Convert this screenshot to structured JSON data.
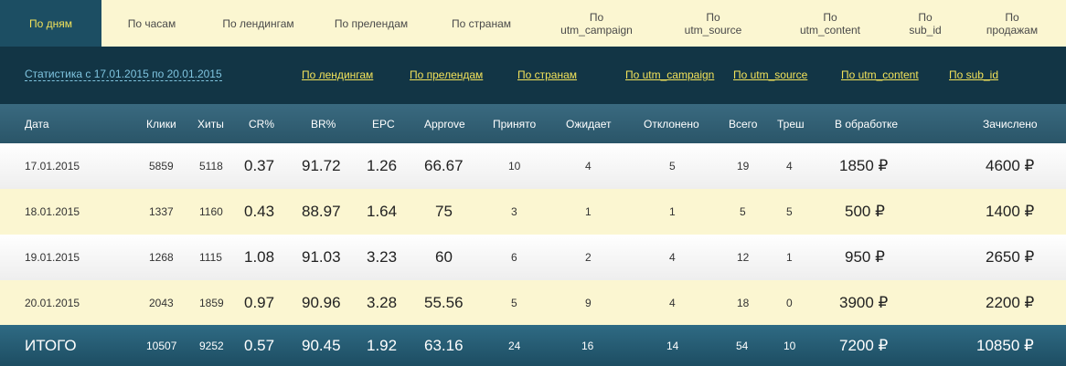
{
  "tabs": [
    {
      "label": "По дням",
      "active": true
    },
    {
      "label": "По часам"
    },
    {
      "label": "По лендингам"
    },
    {
      "label": "По прелендам"
    },
    {
      "label": "По странам"
    },
    {
      "label": "По\nutm_campaign"
    },
    {
      "label": "По\nutm_source"
    },
    {
      "label": "По\nutm_content"
    },
    {
      "label": "По\nsub_id"
    },
    {
      "label": "По\nпродажам"
    }
  ],
  "subnav": {
    "range": "Статистика с 17.01.2015 по 20.01.2015",
    "links": [
      "По лендингам",
      "По прелендам",
      "По странам",
      "По utm_campaign",
      "По utm_source",
      "По utm_content",
      "По sub_id"
    ]
  },
  "headers": [
    "Дата",
    "Клики",
    "Хиты",
    "CR%",
    "BR%",
    "EPC",
    "Approve",
    "Принято",
    "Ожидает",
    "Отклонено",
    "Всего",
    "Треш",
    "В обработке",
    "Зачислено"
  ],
  "rows": [
    {
      "date": "17.01.2015",
      "clicks": "5859",
      "hits": "5118",
      "cr": "0.37",
      "br": "91.72",
      "epc": "1.26",
      "approve": "66.67",
      "accepted": "10",
      "pending": "4",
      "rejected": "5",
      "total": "19",
      "trash": "4",
      "processing": "1850 ₽",
      "credited": "4600 ₽"
    },
    {
      "date": "18.01.2015",
      "clicks": "1337",
      "hits": "1160",
      "cr": "0.43",
      "br": "88.97",
      "epc": "1.64",
      "approve": "75",
      "accepted": "3",
      "pending": "1",
      "rejected": "1",
      "total": "5",
      "trash": "5",
      "processing": "500 ₽",
      "credited": "1400 ₽"
    },
    {
      "date": "19.01.2015",
      "clicks": "1268",
      "hits": "1115",
      "cr": "1.08",
      "br": "91.03",
      "epc": "3.23",
      "approve": "60",
      "accepted": "6",
      "pending": "2",
      "rejected": "4",
      "total": "12",
      "trash": "1",
      "processing": "950 ₽",
      "credited": "2650 ₽"
    },
    {
      "date": "20.01.2015",
      "clicks": "2043",
      "hits": "1859",
      "cr": "0.97",
      "br": "90.96",
      "epc": "3.28",
      "approve": "55.56",
      "accepted": "5",
      "pending": "9",
      "rejected": "4",
      "total": "18",
      "trash": "0",
      "processing": "3900 ₽",
      "credited": "2200 ₽"
    }
  ],
  "totals": {
    "label": "ИТОГО",
    "clicks": "10507",
    "hits": "9252",
    "cr": "0.57",
    "br": "90.45",
    "epc": "1.92",
    "approve": "63.16",
    "accepted": "24",
    "pending": "16",
    "rejected": "14",
    "total": "54",
    "trash": "10",
    "processing": "7200 ₽",
    "credited": "10850 ₽"
  },
  "colors": {
    "tab_bg": "#fbf6d1",
    "tab_active_bg": "#1c4e63",
    "tab_active_text": "#f2e25a",
    "subnav_bg": "#123545",
    "link": "#f2e25a",
    "header_bg": "#2f6076",
    "row_yellow": "#fbf6d1"
  }
}
